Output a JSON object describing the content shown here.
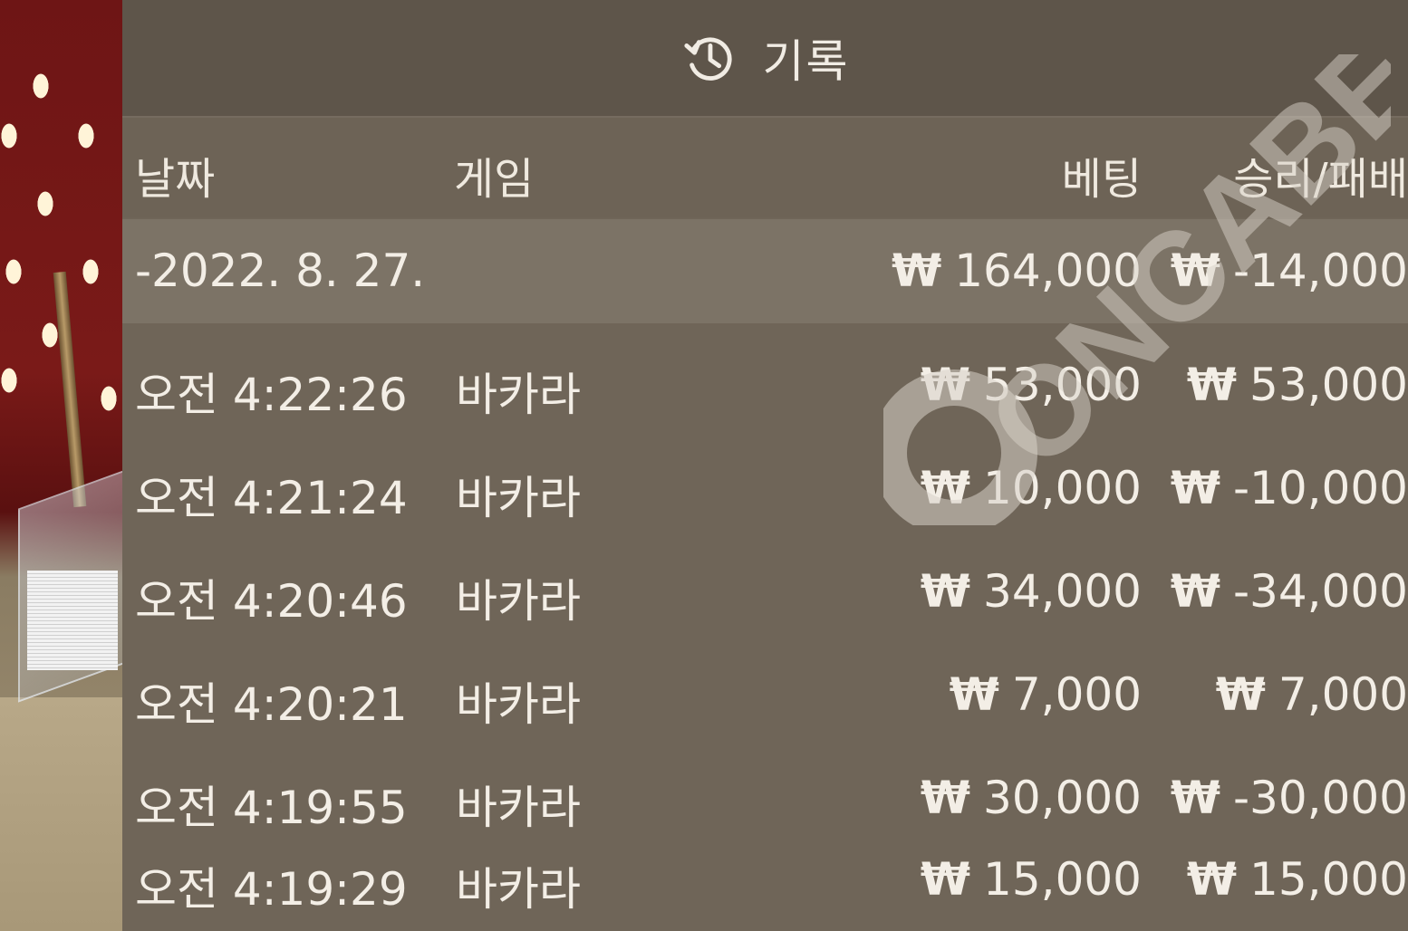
{
  "header": {
    "title": "기록",
    "icon": "history-icon"
  },
  "columns": {
    "date": "날짜",
    "game": "게임",
    "bet": "베팅",
    "win_loss": "승리/패배"
  },
  "summary": {
    "date": "-2022. 8. 27.",
    "currency": "₩",
    "bet": "164,000",
    "win_loss": "-14,000"
  },
  "rows": [
    {
      "time": "오전 4:22:26",
      "game": "바카라",
      "currency": "₩",
      "bet": "53,000",
      "win_loss": "53,000"
    },
    {
      "time": "오전 4:21:24",
      "game": "바카라",
      "currency": "₩",
      "bet": "10,000",
      "win_loss": "-10,000"
    },
    {
      "time": "오전 4:20:46",
      "game": "바카라",
      "currency": "₩",
      "bet": "34,000",
      "win_loss": "-34,000"
    },
    {
      "time": "오전 4:20:21",
      "game": "바카라",
      "currency": "₩",
      "bet": "7,000",
      "win_loss": "7,000"
    },
    {
      "time": "오전 4:19:55",
      "game": "바카라",
      "currency": "₩",
      "bet": "30,000",
      "win_loss": "-30,000"
    },
    {
      "time": "오전 4:19:29",
      "game": "바카라",
      "currency": "₩",
      "bet": "15,000",
      "win_loss": "15,000"
    }
  ],
  "watermark": {
    "text": "ONCABEST"
  },
  "colors": {
    "panel": "#6f6558",
    "header": "#5e554a",
    "summary": "#7c7366",
    "text": "#f3eee6"
  }
}
